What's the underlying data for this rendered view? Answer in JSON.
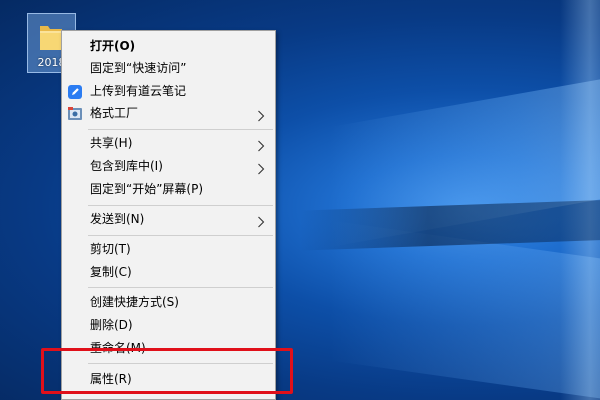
{
  "desktop": {
    "icon": {
      "label": "2018",
      "icon": "folder-icon"
    }
  },
  "context_menu": {
    "items": [
      {
        "label": "打开(O)",
        "bold": true
      },
      {
        "label": "固定到“快速访问”"
      },
      {
        "label": "上传到有道云笔记",
        "icon": "youdao-note-icon",
        "icon_color": "#2b7cf2"
      },
      {
        "label": "格式工厂",
        "icon": "format-factory-icon",
        "submenu": true
      },
      {
        "label": "共享(H)",
        "submenu": true
      },
      {
        "label": "包含到库中(I)",
        "submenu": true
      },
      {
        "label": "固定到“开始”屏幕(P)"
      },
      {
        "label": "发送到(N)",
        "submenu": true
      },
      {
        "label": "剪切(T)"
      },
      {
        "label": "复制(C)"
      },
      {
        "label": "创建快捷方式(S)"
      },
      {
        "label": "删除(D)"
      },
      {
        "label": "重命名(M)"
      },
      {
        "label": "属性(R)"
      }
    ]
  },
  "annotation": {
    "highlight_color": "#e0101a"
  },
  "colors": {
    "menu_background": "#f2f2f2",
    "menu_border": "#a0a0a0",
    "desktop_blue": "#0d4fa8"
  }
}
